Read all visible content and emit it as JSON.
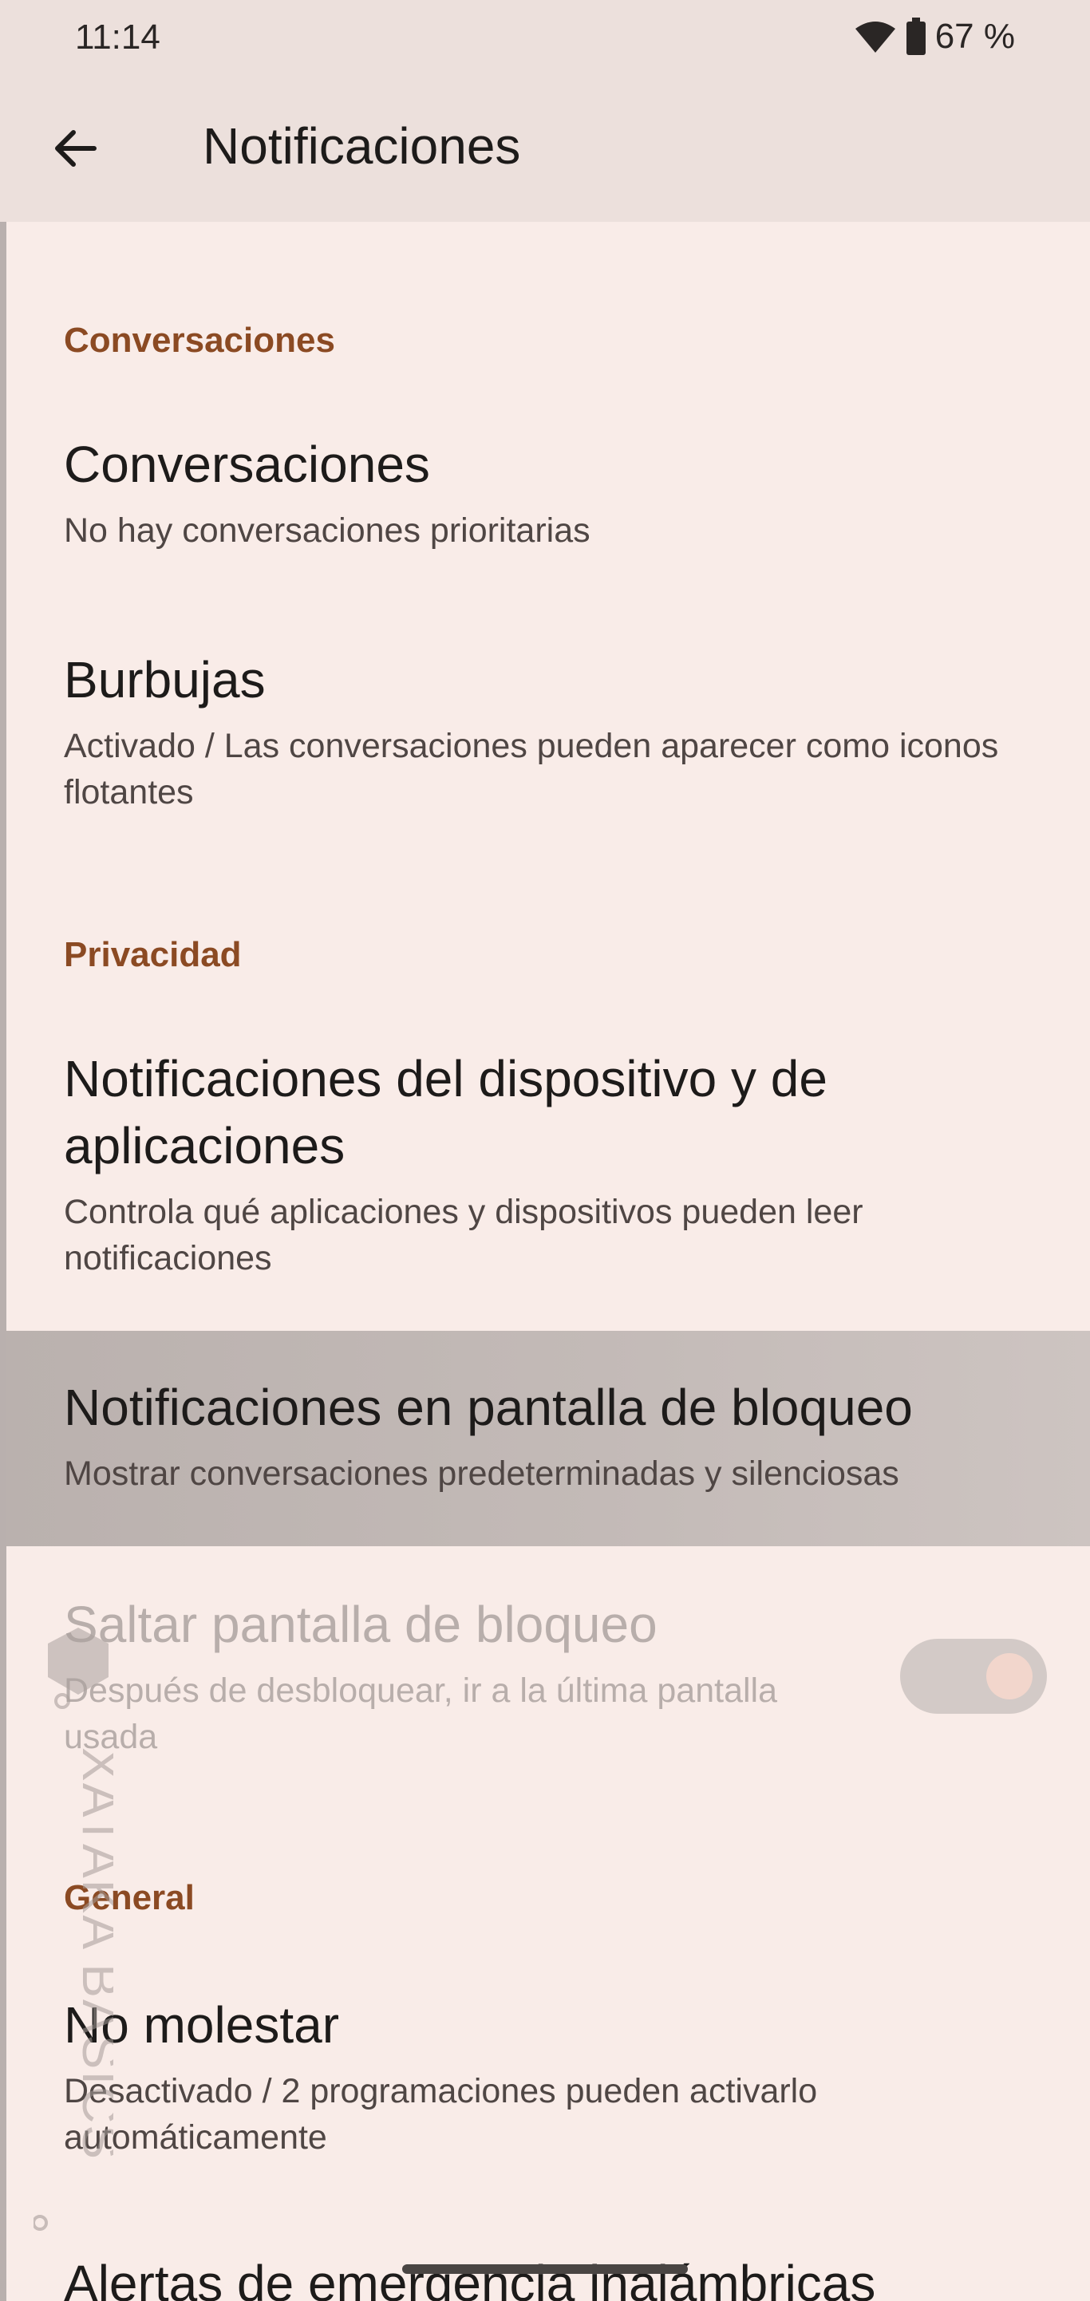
{
  "status_bar": {
    "time": "11:14",
    "battery_percent": "67 %",
    "icons": [
      "wifi-icon",
      "battery-icon"
    ]
  },
  "app_bar": {
    "title": "Notificaciones",
    "back_icon": "arrow-back-icon"
  },
  "sections": {
    "conversaciones": "Conversaciones",
    "privacidad": "Privacidad",
    "general": "General"
  },
  "items": {
    "conversaciones": {
      "title": "Conversaciones",
      "subtitle": "No hay conversaciones prioritarias"
    },
    "burbujas": {
      "title": "Burbujas",
      "subtitle": "Activado / Las conversaciones pueden aparecer como iconos flotantes"
    },
    "dispositivo": {
      "title": "Notificaciones del dispositivo y de aplicaciones",
      "subtitle": "Controla qué aplicaciones y dispositivos pueden leer notificaciones"
    },
    "bloqueo": {
      "title": "Notificaciones en pantalla de bloqueo",
      "subtitle": "Mostrar conversaciones predeterminadas y silenciosas"
    },
    "saltar": {
      "title": "Saltar pantalla de bloqueo",
      "subtitle": "Después de desbloquear, ir a la última pantalla usada",
      "toggle_on": true,
      "enabled": false
    },
    "no_molestar": {
      "title": "No molestar",
      "subtitle": "Desactivado / 2 programaciones pueden activarlo automáticamente"
    },
    "alertas": {
      "title": "Alertas de emergencia inalámbricas"
    }
  },
  "watermark": {
    "text": "XATAKA BASICS"
  },
  "colors": {
    "background": "#f9ece8",
    "header": "#ece0dc",
    "section_accent": "#8b4a23",
    "highlight": "#c3bab7"
  }
}
